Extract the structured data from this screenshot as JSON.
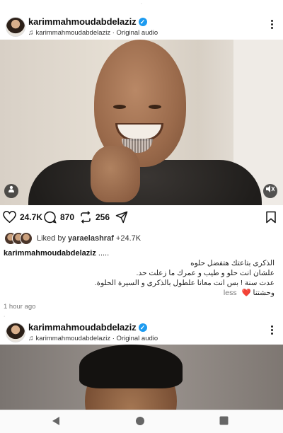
{
  "post1": {
    "username": "karimmahmoudabdelaziz",
    "audio_text": "karimmahmoudabdelaziz · Original audio",
    "likes": "24.7K",
    "comments": "870",
    "reposts": "256",
    "liked_by_prefix": "Liked by ",
    "liked_by_user": "yaraelashraf",
    "liked_by_suffix": " +24.7K",
    "caption_user": "karimmahmoudabdelaziz",
    "caption_ellipsis": " .....",
    "caption_lines": [
      "الذكرى بتاعتك هتفضل حلوه",
      "علشان انت حلو و طيب و عمرك ما زعلت حد.",
      "عدت سنة ! بس انت معانا علطول بالذكرى و السيرة الحلوة.",
      "وحشتنا"
    ],
    "heart": "❤️",
    "less_label": "less",
    "time": "1 hour ago"
  },
  "post2": {
    "username": "karimmahmoudabdelaziz",
    "audio_text": "karimmahmoudabdelaziz · Original audio"
  },
  "icons": {
    "like": "heart-icon",
    "comment": "comment-icon",
    "repost": "repost-icon",
    "share": "send-icon",
    "save": "bookmark-icon",
    "mute": "speaker-icon",
    "tags": "person-icon",
    "more": "more-icon",
    "audio": "music-note-icon",
    "verified": "verified-badge-icon"
  },
  "colors": {
    "verified": "#1d9bf0",
    "heart": "#e0245e",
    "muted_text": "#777777"
  }
}
